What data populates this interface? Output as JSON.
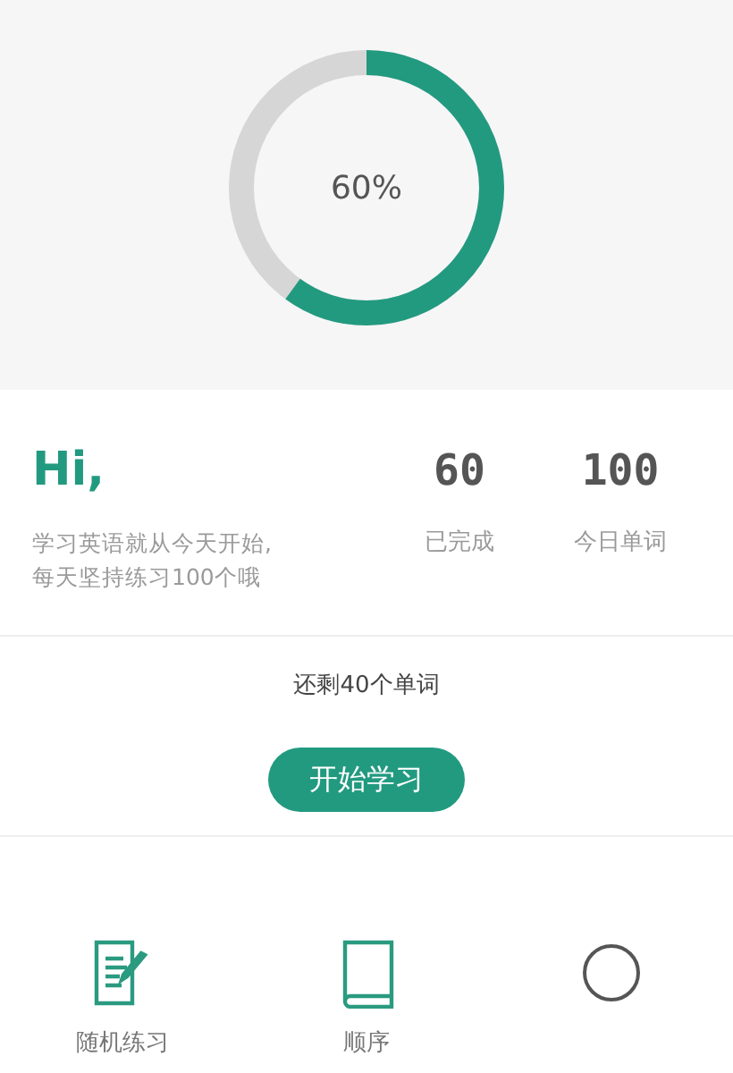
{
  "progress": {
    "level": 0.6,
    "label": "60%"
  },
  "greeting": {
    "title": "Hi,",
    "text": "学习英语就从今天开始,\n每天坚持练习100个哦"
  },
  "stats": [
    {
      "value": "60",
      "label": "已完成"
    },
    {
      "value": "100",
      "label": "今日单词"
    }
  ],
  "remaining": "还剩40个单词",
  "start_button": "开始学习",
  "modes": [
    {
      "kind": "notes",
      "label": "随机练习"
    },
    {
      "kind": "book",
      "label": "顺序"
    },
    {
      "kind": "circle"
    }
  ]
}
